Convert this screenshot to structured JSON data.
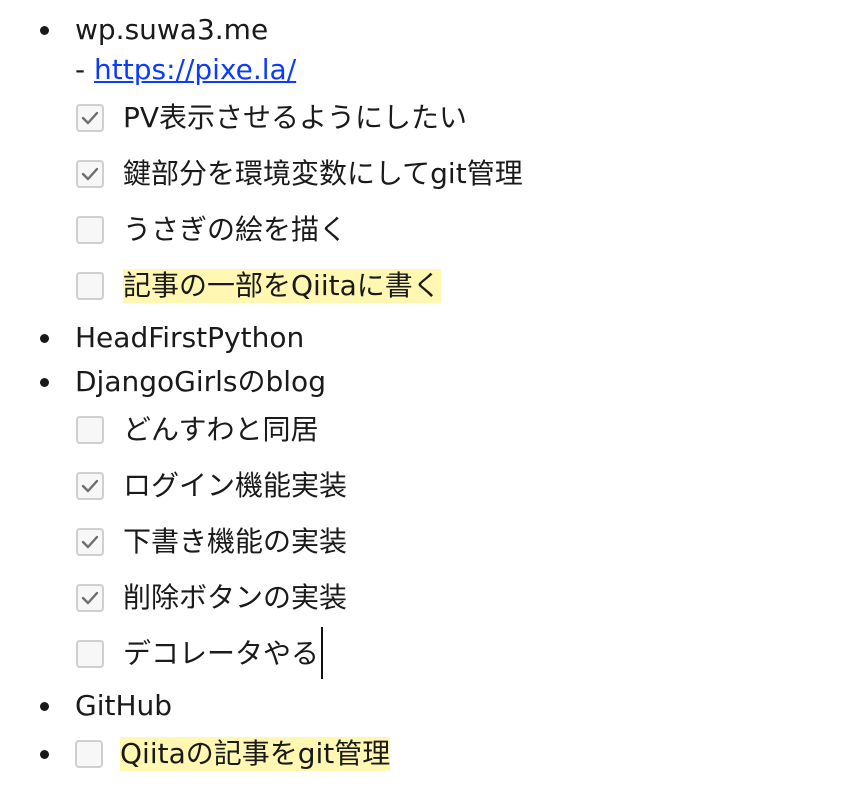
{
  "items": [
    {
      "label": "wp.suwa3.me",
      "note_prefix": "- ",
      "note_link": "https://pixe.la/",
      "tasks": [
        {
          "text": "PV表示させるようにしたい",
          "checked": true,
          "highlight": false
        },
        {
          "text": "鍵部分を環境変数にしてgit管理",
          "checked": true,
          "highlight": false
        },
        {
          "text": "うさぎの絵を描く",
          "checked": false,
          "highlight": false
        },
        {
          "text": "記事の一部をQiitaに書く",
          "checked": false,
          "highlight": true
        }
      ]
    },
    {
      "label": "HeadFirstPython"
    },
    {
      "label": "DjangoGirlsのblog",
      "tasks": [
        {
          "text": "どんすわと同居",
          "checked": false,
          "highlight": false
        },
        {
          "text": "ログイン機能実装",
          "checked": true,
          "highlight": false
        },
        {
          "text": "下書き機能の実装",
          "checked": true,
          "highlight": false
        },
        {
          "text": "削除ボタンの実装",
          "checked": true,
          "highlight": false
        },
        {
          "text": "デコレータやる",
          "checked": false,
          "highlight": false
        }
      ]
    },
    {
      "label": "GitHub"
    },
    {
      "inline_task": {
        "text": "Qiitaの記事をgit管理",
        "checked": false,
        "highlight": true
      }
    }
  ],
  "colors": {
    "link": "#0b3bff",
    "highlight": "#fff7b2",
    "checkmark": "#6e6e6e",
    "checkbox_border": "#cfcfcf"
  },
  "icons": {
    "check": "check-icon"
  }
}
